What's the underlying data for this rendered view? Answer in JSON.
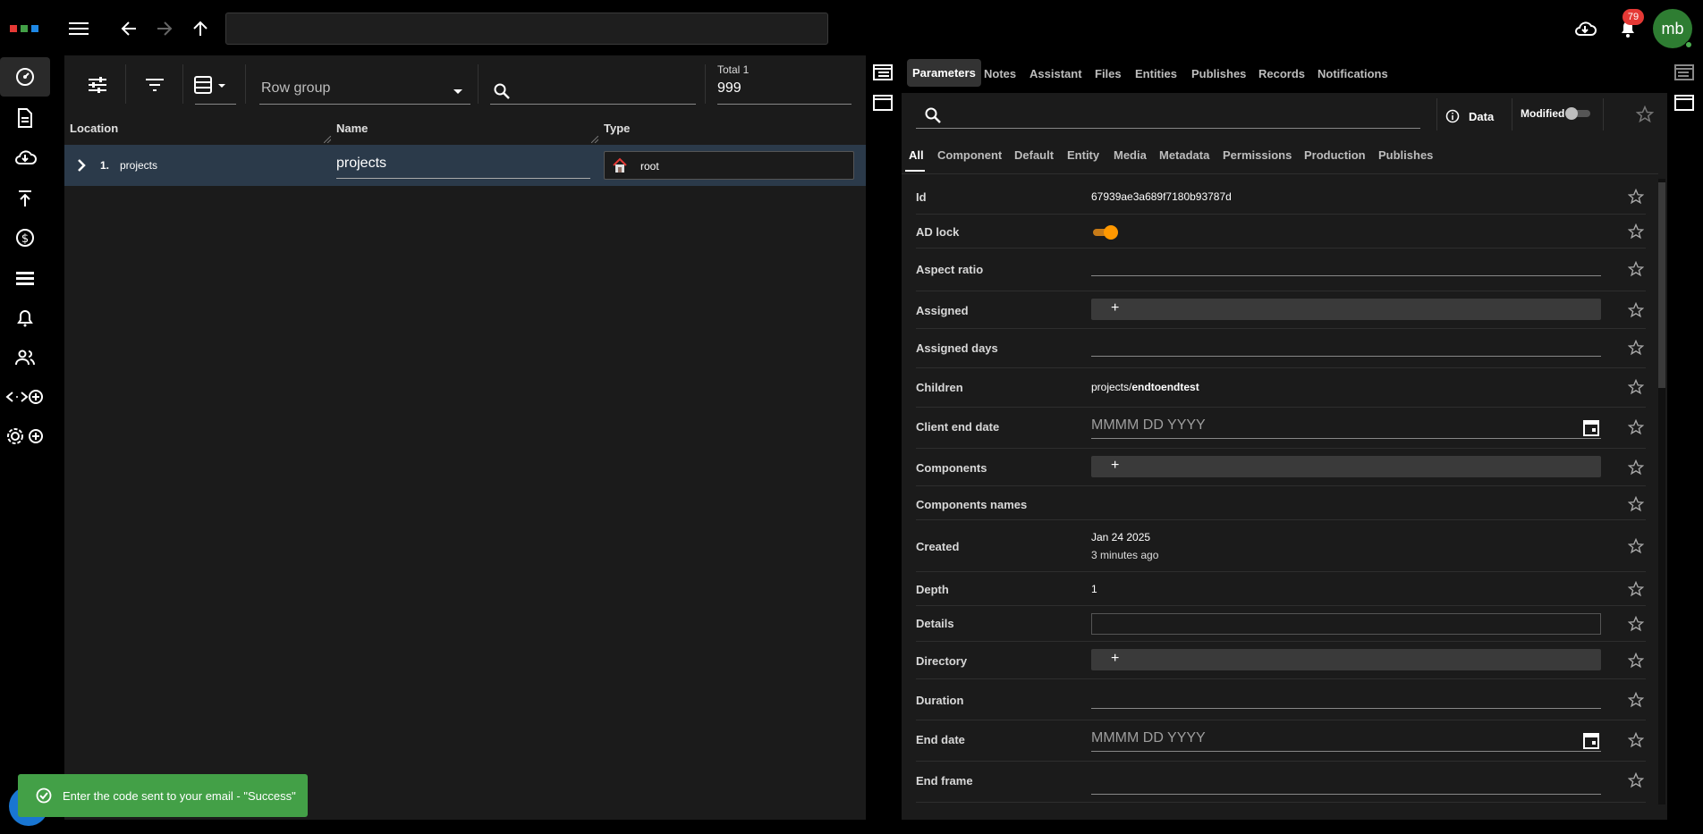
{
  "topbar": {
    "logo_colors": [
      "#e53935",
      "#43a047",
      "#1e88e5"
    ],
    "notifications_count": "79",
    "avatar_initials": "mb",
    "address_value": ""
  },
  "leftnav": {
    "items": [
      "dashboard-icon",
      "document-icon",
      "cloud-download-icon",
      "upload-icon",
      "dollar-icon",
      "list-icon",
      "bell-icon",
      "people-icon",
      "code-add-icon",
      "settings-add-icon"
    ]
  },
  "left_panel": {
    "row_group_label": "Row group",
    "search_value": "",
    "total_label": "Total 1",
    "total_value": "999",
    "columns": [
      "Location",
      "Name",
      "Type"
    ],
    "rows": [
      {
        "index": "1.",
        "location": "projects",
        "name": "projects",
        "type": "root"
      }
    ]
  },
  "right_panel": {
    "tabs": [
      "Parameters",
      "Notes",
      "Assistant",
      "Files",
      "Entities",
      "Publishes",
      "Records",
      "Notifications"
    ],
    "active_tab": "Parameters",
    "data_label": "Data",
    "modified_label": "Modified",
    "subtabs": [
      "All",
      "Component",
      "Default",
      "Entity",
      "Media",
      "Metadata",
      "Permissions",
      "Production",
      "Publishes"
    ],
    "properties": {
      "id": {
        "label": "Id",
        "value": "67939ae3a689f7180b93787d"
      },
      "ad_lock": {
        "label": "AD lock"
      },
      "aspect_ratio": {
        "label": "Aspect ratio"
      },
      "assigned": {
        "label": "Assigned",
        "plus": "+"
      },
      "assigned_days": {
        "label": "Assigned days"
      },
      "children": {
        "label": "Children",
        "prefix": "projects/",
        "value": "endtoendtest"
      },
      "client_end_date": {
        "label": "Client end date",
        "placeholder": "MMMM DD YYYY"
      },
      "components": {
        "label": "Components",
        "plus": "+"
      },
      "components_names": {
        "label": "Components names"
      },
      "created": {
        "label": "Created",
        "value": "Jan 24 2025",
        "relative": "3 minutes ago"
      },
      "depth": {
        "label": "Depth",
        "value": "1"
      },
      "details": {
        "label": "Details"
      },
      "directory": {
        "label": "Directory",
        "plus": "+"
      },
      "duration": {
        "label": "Duration"
      },
      "end_date": {
        "label": "End date",
        "placeholder": "MMMM DD YYYY"
      },
      "end_frame": {
        "label": "End frame"
      }
    }
  },
  "toast": {
    "message": "Enter the code sent to your email - \"Success\""
  },
  "colors": {
    "accent_orange": "#ff9800",
    "toast_green": "#43a047",
    "row_selected": "#2b3a4a"
  }
}
